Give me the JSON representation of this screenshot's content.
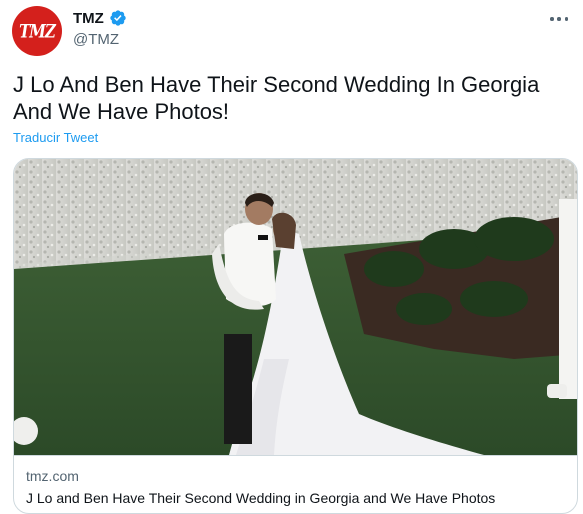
{
  "author": {
    "avatar_text": "TMZ",
    "display_name": "TMZ",
    "handle": "@TMZ",
    "verified": true
  },
  "tweet": {
    "text": "J Lo And Ben Have Their Second Wedding In Georgia And We Have Photos!",
    "translate_label": "Traducir Tweet"
  },
  "card": {
    "domain": "tmz.com",
    "title": "J Lo and Ben Have Their Second Wedding in Georgia and We Have Photos"
  },
  "colors": {
    "brand": "#d4201c",
    "link": "#1d9bf0",
    "verified": "#1d9bf0",
    "secondary_text": "#536471"
  },
  "icons": {
    "verified": "verified-badge-icon",
    "more": "more-options-icon"
  }
}
